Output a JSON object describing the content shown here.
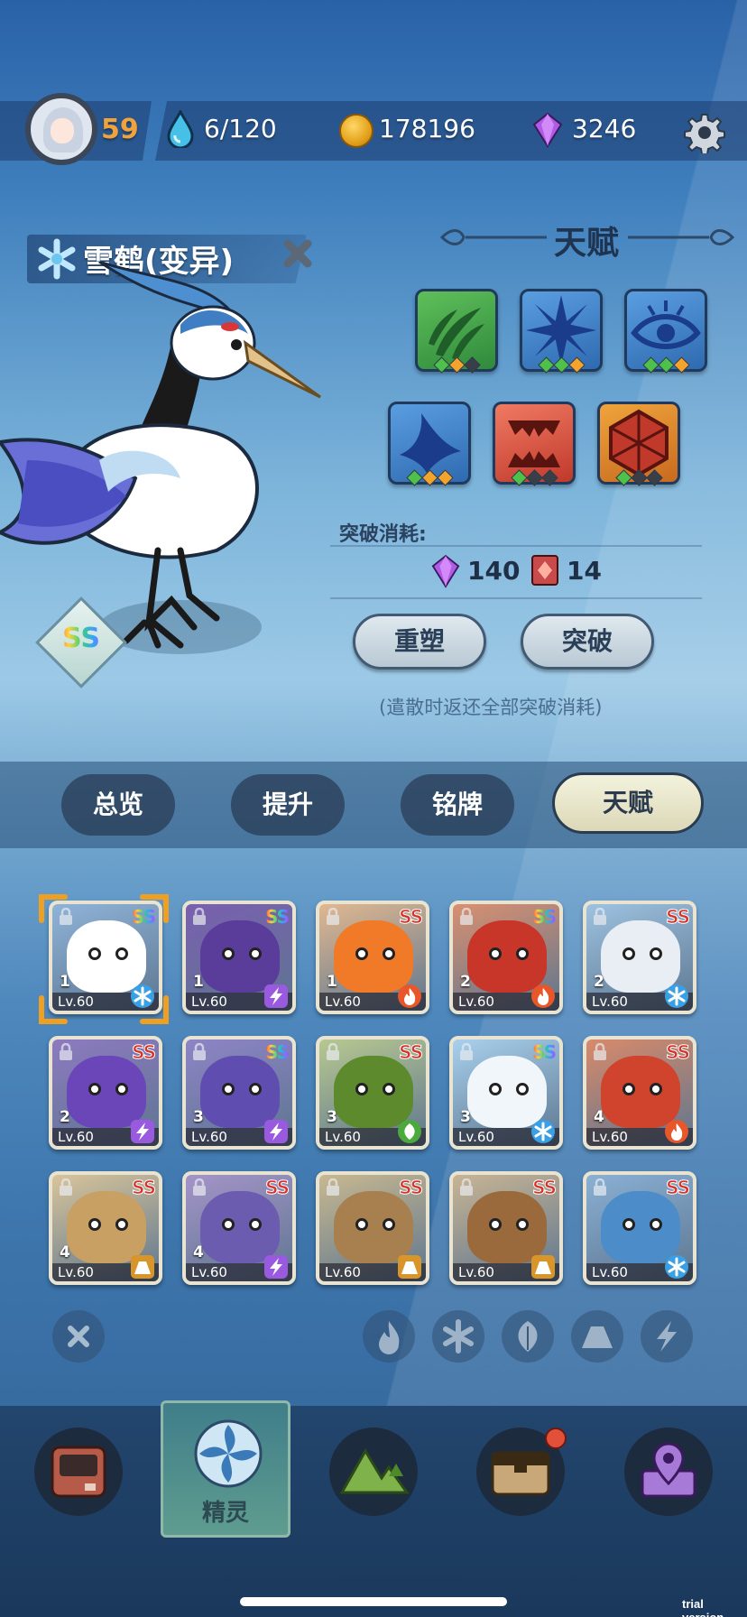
{
  "player": {
    "level": "59",
    "stamina": "6/120",
    "coins": "178196",
    "gems": "3246"
  },
  "pet": {
    "name": "雪鹤(变异)",
    "grade": "SS"
  },
  "talent": {
    "title": "天赋",
    "skills": [
      {
        "icon": "claw-slash-icon",
        "color": "#3f9a4a",
        "pips": [
          "g",
          "o",
          "d"
        ]
      },
      {
        "icon": "ice-cross-icon",
        "color": "#3b7fc2",
        "pips": [
          "g",
          "g",
          "o"
        ]
      },
      {
        "icon": "eye-icon",
        "color": "#3b7fc2",
        "pips": [
          "g",
          "g",
          "o"
        ]
      },
      {
        "icon": "fin-icon",
        "color": "#3b7fc2",
        "pips": [
          "g",
          "o",
          "o"
        ]
      },
      {
        "icon": "jaws-icon",
        "color": "#d24a3a",
        "pips": [
          "g",
          "d",
          "d"
        ]
      },
      {
        "icon": "hex-shield-icon",
        "color": "#d88a2a",
        "pips": [
          "g",
          "d",
          "d"
        ]
      }
    ],
    "break_cost_label": "突破消耗:",
    "cost_gems": "140",
    "cost_cards": "14",
    "reshape_label": "重塑",
    "break_label": "突破",
    "note": "(遣散时返还全部突破消耗)"
  },
  "tabs": [
    {
      "label": "总览",
      "active": false
    },
    {
      "label": "提升",
      "active": false
    },
    {
      "label": "铭牌",
      "active": false
    },
    {
      "label": "天赋",
      "active": true
    }
  ],
  "monsters": [
    {
      "rank": "1",
      "level": "Lv.60",
      "grade": "SS",
      "element": "ice",
      "bg": "#8fb3d8",
      "body": "#ffffff"
    },
    {
      "rank": "1",
      "level": "Lv.60",
      "grade": "SS",
      "element": "thunder",
      "bg": "#7a5fb0",
      "body": "#5a3c9a"
    },
    {
      "rank": "1",
      "level": "Lv.60",
      "grade": "SS",
      "element": "fire",
      "bg": "#e0b890",
      "body": "#f07a28"
    },
    {
      "rank": "2",
      "level": "Lv.60",
      "grade": "SS",
      "element": "fire",
      "bg": "#d89070",
      "body": "#c8362a"
    },
    {
      "rank": "2",
      "level": "Lv.60",
      "grade": "SS",
      "element": "ice",
      "bg": "#9dc2e0",
      "body": "#e8eef4"
    },
    {
      "rank": "2",
      "level": "Lv.60",
      "grade": "SS",
      "element": "thunder",
      "bg": "#8d7ac0",
      "body": "#6a46b8"
    },
    {
      "rank": "3",
      "level": "Lv.60",
      "grade": "SS",
      "element": "thunder",
      "bg": "#8e84c6",
      "body": "#5f4eb0"
    },
    {
      "rank": "3",
      "level": "Lv.60",
      "grade": "SS",
      "element": "wood",
      "bg": "#b8c890",
      "body": "#5c8a2c"
    },
    {
      "rank": "3",
      "level": "Lv.60",
      "grade": "SS",
      "element": "ice",
      "bg": "#a8d0ec",
      "body": "#f0f6fa"
    },
    {
      "rank": "4",
      "level": "Lv.60",
      "grade": "SS",
      "element": "fire",
      "bg": "#d88a6a",
      "body": "#d0432c"
    },
    {
      "rank": "4",
      "level": "Lv.60",
      "grade": "SS",
      "element": "earth",
      "bg": "#d8c49a",
      "body": "#c8a064"
    },
    {
      "rank": "4",
      "level": "Lv.60",
      "grade": "SS",
      "element": "thunder",
      "bg": "#a494c8",
      "body": "#6c5cb0"
    },
    {
      "rank": "",
      "level": "Lv.60",
      "grade": "SS",
      "element": "earth",
      "bg": "#c8b890",
      "body": "#a88050"
    },
    {
      "rank": "",
      "level": "Lv.60",
      "grade": "SS",
      "element": "earth",
      "bg": "#c8b494",
      "body": "#9a6a3c"
    },
    {
      "rank": "",
      "level": "Lv.60",
      "grade": "SS",
      "element": "ice",
      "bg": "#8ab0d4",
      "body": "#4c8cc8"
    }
  ],
  "filters": [
    "clear-icon",
    "fire-filter-icon",
    "ice-filter-icon",
    "wood-filter-icon",
    "earth-filter-icon",
    "thunder-filter-icon"
  ],
  "nav": {
    "active_label": "精灵"
  },
  "watermark": "trial version"
}
